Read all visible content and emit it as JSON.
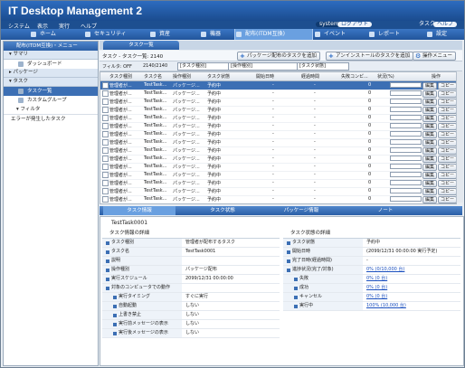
{
  "app": {
    "title": "IT Desktop Management 2"
  },
  "menu": {
    "items": [
      "システム",
      "表示",
      "実行",
      "ヘルプ"
    ],
    "system_label": "system",
    "logout_label": "ログアウト",
    "task_label": "タスク",
    "help_label": "ヘルプ"
  },
  "nav": {
    "items": [
      {
        "label": "ホーム"
      },
      {
        "label": "セキュリティ"
      },
      {
        "label": "資産"
      },
      {
        "label": "機器"
      },
      {
        "label": "配布(ITDM互換)"
      },
      {
        "label": "イベント"
      },
      {
        "label": "レポート"
      },
      {
        "label": "設定"
      }
    ]
  },
  "sidebar": {
    "header": "配布(ITDM互換)・メニュー",
    "sections": [
      {
        "label": "サマリ",
        "items": [
          "ダッシュボード"
        ]
      },
      {
        "label": "パッケージ",
        "items": []
      },
      {
        "label": "タスク",
        "items": [
          "タスク一覧",
          "カスタムグループ"
        ]
      }
    ],
    "filter_label": "フィルタ",
    "error_label": "エラーが発生したタスク"
  },
  "main": {
    "tab_label": "タスク一覧",
    "toolbar": {
      "count_label": "タスク - タスク一覧: 2140",
      "add_package_task": "パッケージ配布のタスクを追加",
      "add_uninstall_task": "アンインストールのタスクを追加",
      "operation_menu": "操作メニュー"
    },
    "filter": {
      "label": "フィルタ: OFF",
      "count": "2140/2140",
      "select1": "[タスク種別]",
      "select2": "[操作種別]",
      "select3": "[タスク状態]"
    }
  },
  "grid": {
    "columns": [
      "タスク種別",
      "タスク名",
      "操作種別",
      "タスク状態",
      "開始日時",
      "経過時間",
      "失敗コンピ...",
      "状況(%)",
      "操作"
    ],
    "rows": [
      {
        "type": "管理者が...",
        "name": "TestTask...",
        "op": "パッケージ...",
        "state": "予約中",
        "start": "-",
        "elapsed": "-",
        "fail": "0",
        "selected": true
      },
      {
        "type": "管理者が...",
        "name": "TestTask...",
        "op": "パッケージ...",
        "state": "予約中",
        "start": "-",
        "elapsed": "-",
        "fail": "0"
      },
      {
        "type": "管理者が...",
        "name": "TestTask...",
        "op": "パッケージ...",
        "state": "予約中",
        "start": "-",
        "elapsed": "-",
        "fail": "0"
      },
      {
        "type": "管理者が...",
        "name": "TestTask...",
        "op": "パッケージ...",
        "state": "予約中",
        "start": "-",
        "elapsed": "-",
        "fail": "0"
      },
      {
        "type": "管理者が...",
        "name": "TestTask...",
        "op": "パッケージ...",
        "state": "予約中",
        "start": "-",
        "elapsed": "-",
        "fail": "0"
      },
      {
        "type": "管理者が...",
        "name": "TestTask...",
        "op": "パッケージ...",
        "state": "予約中",
        "start": "-",
        "elapsed": "-",
        "fail": "0"
      },
      {
        "type": "管理者が...",
        "name": "TestTask...",
        "op": "パッケージ...",
        "state": "予約中",
        "start": "-",
        "elapsed": "-",
        "fail": "0"
      },
      {
        "type": "管理者が...",
        "name": "TestTask...",
        "op": "パッケージ...",
        "state": "予約中",
        "start": "-",
        "elapsed": "-",
        "fail": "0"
      },
      {
        "type": "管理者が...",
        "name": "TestTask...",
        "op": "パッケージ...",
        "state": "予約中",
        "start": "-",
        "elapsed": "-",
        "fail": "0"
      },
      {
        "type": "管理者が...",
        "name": "TestTask...",
        "op": "パッケージ...",
        "state": "予約中",
        "start": "-",
        "elapsed": "-",
        "fail": "0"
      },
      {
        "type": "管理者が...",
        "name": "TestTask...",
        "op": "パッケージ...",
        "state": "予約中",
        "start": "-",
        "elapsed": "-",
        "fail": "0"
      },
      {
        "type": "管理者が...",
        "name": "TestTask...",
        "op": "パッケージ...",
        "state": "予約中",
        "start": "-",
        "elapsed": "-",
        "fail": "0"
      },
      {
        "type": "管理者が...",
        "name": "TestTask...",
        "op": "パッケージ...",
        "state": "予約中",
        "start": "-",
        "elapsed": "-",
        "fail": "0"
      },
      {
        "type": "管理者が...",
        "name": "TestTask...",
        "op": "パッケージ...",
        "state": "予約中",
        "start": "-",
        "elapsed": "-",
        "fail": "0"
      },
      {
        "type": "管理者が...",
        "name": "TestTask...",
        "op": "パッケージ...",
        "state": "予約中",
        "start": "-",
        "elapsed": "-",
        "fail": "0"
      }
    ],
    "edit_label": "編集",
    "copy_label": "コピー"
  },
  "detail": {
    "tabs": [
      "タスク情報",
      "タスク状態",
      "パッケージ情報",
      "ノート"
    ],
    "title": "TestTask0001",
    "left_header": "タスク情報の詳細",
    "left": [
      {
        "k": "タスク種別",
        "v": "管理者が配布するタスク"
      },
      {
        "k": "タスク名",
        "v": "TestTask0001"
      },
      {
        "k": "説明",
        "v": ""
      },
      {
        "k": "操作種別",
        "v": "パッケージ配布"
      },
      {
        "k": "実行スケジュール",
        "v": "2099/12/31 00:00:00"
      },
      {
        "k": "対象のコンピュータでの動作",
        "v": ""
      },
      {
        "k": "実行タイミング",
        "v": "すぐに実行",
        "sub": true
      },
      {
        "k": "自動起動",
        "v": "しない",
        "sub": true
      },
      {
        "k": "上書き禁止",
        "v": "しない",
        "sub": true
      },
      {
        "k": "実行前メッセージの表示",
        "v": "しない",
        "sub": true
      },
      {
        "k": "実行後メッセージの表示",
        "v": "しない",
        "sub": true
      }
    ],
    "right_header": "タスク状態の詳細",
    "right": [
      {
        "k": "タスク状態",
        "v": "予約中"
      },
      {
        "k": "開始日時",
        "v": "(2099/12/31 00:00:00 実行予定)"
      },
      {
        "k": "完了日時(経過時間)",
        "v": "-"
      },
      {
        "k": "進捗状況(完了/対象)",
        "v": "0% (0/10,000 台)",
        "link": true
      },
      {
        "k": "失敗",
        "v": "0% (0 台)",
        "link": true,
        "sub": true
      },
      {
        "k": "成功",
        "v": "0% (0 台)",
        "link": true,
        "sub": true
      },
      {
        "k": "キャンセル",
        "v": "0% (0 台)",
        "link": true,
        "sub": true
      },
      {
        "k": "実行中",
        "v": "100% (10,000 台)",
        "link": true,
        "sub": true
      }
    ]
  }
}
